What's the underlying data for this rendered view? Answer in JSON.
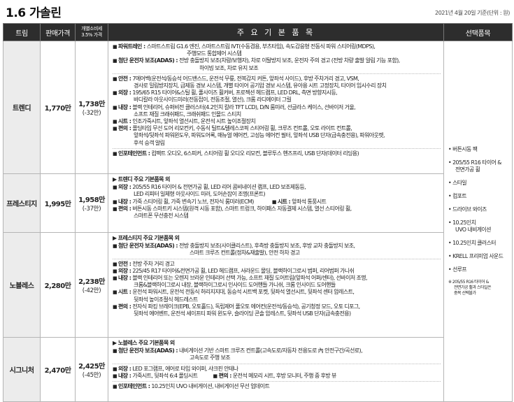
{
  "title": "1.6 가솔린",
  "date_note": "2021년 4월 20일 기준(단위 : 원)",
  "headers": {
    "trim": "트림",
    "price": "판매가격",
    "ind": "개별소비세\n3.5% 가격",
    "main": "주 요 기 본 품 목",
    "option": "선택품목"
  },
  "rows": [
    {
      "trim": "트렌디",
      "price": "1,770만",
      "ind_price": "1,738만",
      "ind_diff": "(-32만)"
    },
    {
      "trim": "프레스티지",
      "price": "1,995만",
      "ind_price": "1,958만",
      "ind_diff": "(-37만)"
    },
    {
      "trim": "노블레스",
      "price": "2,280만",
      "ind_price": "2,238만",
      "ind_diff": "(-42만)"
    },
    {
      "trim": "시그니처",
      "price": "2,470만",
      "ind_price": "2,425만",
      "ind_diff": "(-45만)"
    }
  ],
  "trendy": {
    "powertrain_label": "파워트레인 :",
    "powertrain_1": "스마트스트림 G1.6 엔진, 스마트스트림 IVT(수동겸용, 부츠타입), 속도감응형 전동식 파워 스티어링(MDPS),",
    "powertrain_2": "주행모드 통합제어 시스템",
    "adas_label": "첨단 운전자 보조(ADAS) :",
    "adas_1": "전방 충돌방지 보조(차량/보행자), 차로 이탈방지 보조, 운전자 주의 경고 (전방 차량 출발 알림 기능 포함),",
    "adas_2": "하이빔 보조, 차로 유지 보조",
    "safety_label": "안전 :",
    "safety_1": "7에어백(운전석/동승석 어드밴스드, 운전석 무릎, 전복감지 커튼, 앞좌석 사이드), 후방 주차거리 경고, VSM,",
    "safety_2": "경사로 밀림방지장치, 급제동 경보 시스템, 개별 타이어 공기압 경보 시스템, 유아용 시트 고정장치, 타이어 임시수리 장치",
    "ext_label": "외장 :",
    "ext_1": "195/65 R15 타이어&스틸 휠, 풀사이즈 휠커버, 프로젝션 헤드램프, LED DRL, 측면 방향지시등,",
    "ext_2": "바디칼라 아웃사이드미러(전동접이, 전동조절, 열선), 크롬 라디에이터 그릴",
    "int_label": "내장 :",
    "int_1": "블랙 인테리어, 슈퍼비전 클러스터(4.2인치 칼라 TFT LCD), D/N 룸미러, 선글라스 케이스, 선바이저 거울,",
    "int_2": "소프트 재질 크래쉬패드, 크래쉬패드 인몰드 스티치",
    "seat_label": "시트 :",
    "seat_1": "인조가죽시트, 앞좌석 열선시트, 운전석 시트 높이조절장치",
    "conv_label": "편의 :",
    "conv_1": "폴딩타입 무선 도어 리모컨키, 수동식 틸트&텔레스코픽 스티어링 휠, 크루즈 컨트롤, 오토 라이트 컨트롤,",
    "conv_2": "앞좌석/뒷좌석 파워윈도우, 파워도어록, 매뉴얼 에어컨, 고성능 에어컨 필터, 앞좌석 USB 단자(급속충전용), 파워아웃렛,",
    "conv_3": "후석 승객 알림",
    "info_label": "인포테인먼트 :",
    "info_1": "컴팩트 오디오, 6스피커, 스티어링 휠 오디오 리모컨, 블루투스 핸즈프리, USB 단자(데이터 리딩용)"
  },
  "prestige": {
    "header": "▶ 트렌디 주요 기본품목 외",
    "ext_label": "외장 :",
    "ext_1": "205/55 R16 타이어 & 전면가공 휠, LED 리어 콤비네이션 램프, LED 보조제동등,",
    "ext_2": "LED 리피터 일체형 아웃사이드 미러, 도어손잡이 조명(프론트)",
    "int_label": "내장 :",
    "int_1": "가죽 스티어링 휠, 가죽 변속기 노브, 전자식 룸미러(ECM)",
    "seat_label": "시트 :",
    "seat_1": "앞좌석 통풍시트",
    "conv_label": "편의 :",
    "conv_1": "버튼시동 스마트키 시스템(원격 시동 포함), 스마트 트렁크, 하이패스 자동결제 시스템, 열선 스티어링 휠,",
    "conv_2": "스마트폰 무선충전 시스템"
  },
  "noblesse": {
    "header": "▶ 프레스티지 주요 기본품목 외",
    "adas_label": "첨단 운전자 보조(ADAS) :",
    "adas_1": "전방 충돌방지 보조(사이클리스트), 후측방 충돌방지 보조, 후방 교차 충돌방지 보조,",
    "adas_2": "스마트 크루즈 컨트롤(정차&재출발), 안전 하차 경고",
    "safety_label": "안전 :",
    "safety_1": "전방 주차 거리 경고",
    "ext_label": "외장 :",
    "ext_1": "225/45 R17 타이어&전면가공 휠, LED 헤드램프, 서라운드 몰딩, 블랙하이그로시 범퍼, 리어범퍼 가니쉬",
    "int_label": "내장 :",
    "int_1": "블랙 인테리어 또는 오렌지 브라운 인테리어 선택 가능, 소프트 재질 도어트림(앞좌석 어퍼/센터), 선바이저 조명,",
    "int_2": "크롬&블랙하이그로시 내장, 블랙하이그로시 인사이드 도어핸들 가니쉬, 크롬 인사이드 도어핸들",
    "seat_label": "시트 :",
    "seat_1": "운전석 파워시트, 운전석 전동식 허리지지대, 동승석 시트백 포켓, 뒷좌석 열선시트, 뒷좌석 센터 암레스트,",
    "seat_2": "뒷좌석 높이조절식 헤드레스트",
    "conv_label": "편의 :",
    "conv_1": "전자식 파킹 브레이크(EPB, 오토홀드), 독립제어 풀오토 에어컨(운전석/동승석), 공기청정 모드, 오토 디포그,",
    "conv_2": "뒷좌석 에어벤트, 운전석 세이프티 파워 윈도우, 슬라이딩 콘솔 암레스트, 뒷좌석 USB 단자(급속충전용)"
  },
  "signature": {
    "header": "▶ 노블레스 주요 기본품목 외",
    "adas_label": "첨단 운전자 보조(ADAS) :",
    "adas_1": "내비게이션 기반 스마트 크루즈 컨트롤(고속도로/자동차 전용도로 內 안전구간/곡선로),",
    "adas_2": "고속도로 주행 보조",
    "ext_label": "외장 :",
    "ext_1": "LED 포그램프, 에어로 타입 와이퍼, 샤크핀 안테나",
    "int_label": "내장 :",
    "int_1": "가죽시트, 뒷좌석 6:4 폴딩시트",
    "conv_label": "편의 :",
    "conv_1": "운전석 메모리 시트, 후방 모니터, 주행 중 후방 뷰",
    "info_label": "인포테인먼트 :",
    "info_1": "10.25인치 UVO 내비게이션, 내비게이션 무선 업데이트"
  },
  "options": [
    "버튼시동 팩",
    "205/55 R16 타이어 &",
    "전면가공 휠",
    "스타일",
    "컴포트",
    "드라이브 와이즈",
    "10.25인치",
    "UVO 내비게이션",
    "10.25인치 클러스터",
    "KRELL 프리미엄 사운드",
    "선루프"
  ],
  "option_note_1": "※ 205/55 R16 타이어 &",
  "option_note_2": "전면가공 휠과 스타일은",
  "option_note_3": "중복 선택불가"
}
